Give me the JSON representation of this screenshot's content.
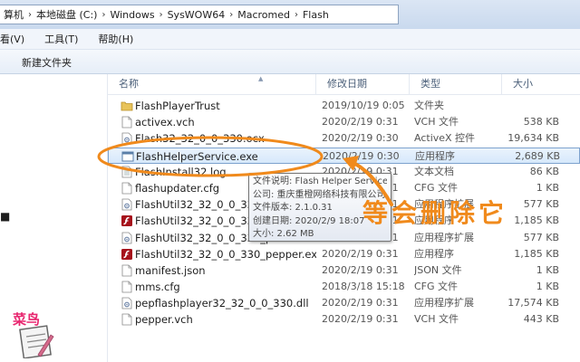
{
  "address": {
    "crumbs": [
      "算机",
      "本地磁盘 (C:)",
      "Windows",
      "SysWOW64",
      "Macromed",
      "Flash"
    ],
    "separator": "›"
  },
  "menu": {
    "items": [
      "看(V)",
      "工具(T)",
      "帮助(H)"
    ]
  },
  "toolbar": {
    "new_folder": "新建文件夹"
  },
  "columns": {
    "name": "名称",
    "date": "修改日期",
    "type": "类型",
    "size": "大小"
  },
  "files": [
    {
      "name": "FlashPlayerTrust",
      "date": "2019/10/19 0:05",
      "type": "文件夹",
      "size": "",
      "icon": "folder-icon",
      "selected": false
    },
    {
      "name": "activex.vch",
      "date": "2020/2/19 0:31",
      "type": "VCH 文件",
      "size": "538 KB",
      "icon": "file-icon",
      "selected": false
    },
    {
      "name": "Flash32_32_0_0_330.ocx",
      "date": "2020/2/19 0:30",
      "type": "ActiveX 控件",
      "size": "19,634 KB",
      "icon": "settings-file-icon",
      "selected": false
    },
    {
      "name": "FlashHelperService.exe",
      "date": "2020/2/19 0:30",
      "type": "应用程序",
      "size": "2,689 KB",
      "icon": "exe-icon",
      "selected": true
    },
    {
      "name": "FlashInstall32.log",
      "date": "2020/2/19 0:31",
      "type": "文本文档",
      "size": "86 KB",
      "icon": "text-file-icon",
      "selected": false
    },
    {
      "name": "flashupdater.cfg",
      "date": "2020/2/19 0:31",
      "type": "CFG 文件",
      "size": "1 KB",
      "icon": "file-icon",
      "selected": false
    },
    {
      "name": "FlashUtil32_32_0_0_330_A",
      "date": "2020/2/19 0:31",
      "type": "应用程序扩展",
      "size": "577 KB",
      "icon": "settings-file-icon",
      "selected": false
    },
    {
      "name": "FlashUtil32_32_0_0_330_A",
      "date": "2020/2/19 0:31",
      "type": "应用程序",
      "size": "1,185 KB",
      "icon": "flash-icon",
      "selected": false
    },
    {
      "name": "FlashUtil32_32_0_0_330_p",
      "date": "2020/2/19 0:31",
      "type": "应用程序扩展",
      "size": "577 KB",
      "icon": "settings-file-icon",
      "selected": false
    },
    {
      "name": "FlashUtil32_32_0_0_330_pepper.exe",
      "date": "2020/2/19 0:31",
      "type": "应用程序",
      "size": "1,185 KB",
      "icon": "flash-icon",
      "selected": false
    },
    {
      "name": "manifest.json",
      "date": "2020/2/19 0:31",
      "type": "JSON 文件",
      "size": "1 KB",
      "icon": "file-icon",
      "selected": false
    },
    {
      "name": "mms.cfg",
      "date": "2018/3/18 15:18",
      "type": "CFG 文件",
      "size": "1 KB",
      "icon": "file-icon",
      "selected": false
    },
    {
      "name": "pepflashplayer32_32_0_0_330.dll",
      "date": "2020/2/19 0:31",
      "type": "应用程序扩展",
      "size": "17,574 KB",
      "icon": "settings-file-icon",
      "selected": false
    },
    {
      "name": "pepper.vch",
      "date": "2020/2/19 0:31",
      "type": "VCH 文件",
      "size": "443 KB",
      "icon": "file-icon",
      "selected": false
    }
  ],
  "tooltip": {
    "lines": [
      "文件说明: Flash Helper Service",
      "公司: 重庆重橙网络科技有限公司",
      "文件版本: 2.1.0.31",
      "创建日期: 2020/2/9 18:07",
      "大小: 2.62 MB"
    ]
  },
  "annotation": {
    "text": "等会删除它",
    "color": "#f08a1c"
  },
  "logo": {
    "text": "菜鸟"
  },
  "colors": {
    "selection_border": "#7da2ce",
    "selection_fill": "#dbeafb",
    "folder": "#e8c35a"
  }
}
